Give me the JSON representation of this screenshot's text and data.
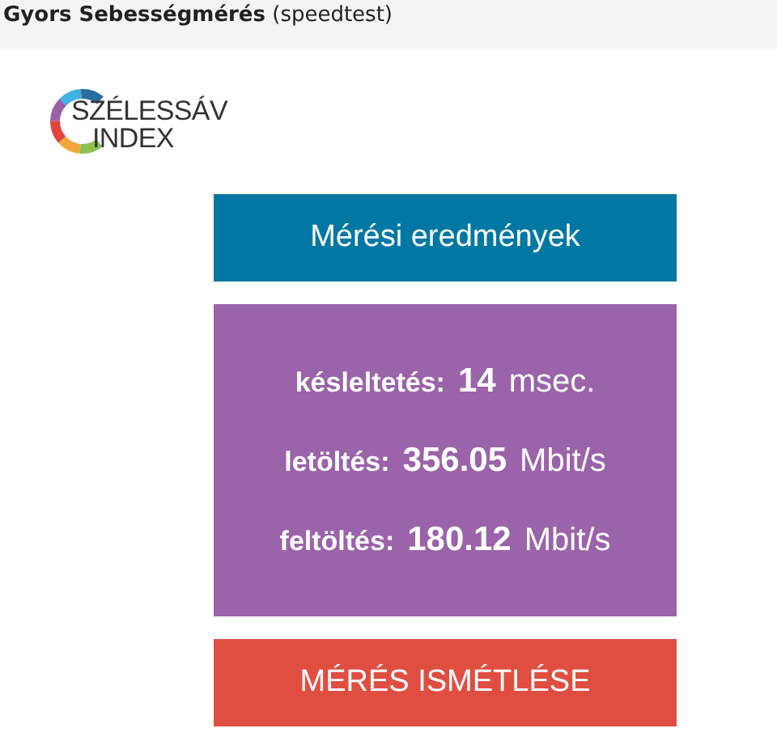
{
  "header": {
    "title": "**Gyors Sebességmérés** (speedtest)"
  },
  "logo": {
    "line_1": "SZÉLESSÁV",
    "line_2": "INDEX"
  },
  "results_heading": "Mérési eredmények",
  "results": [
    {
      "label": "késleltetés:",
      "value": "14",
      "unit": "msec."
    },
    {
      "label": "letöltés:",
      "value": "356.05",
      "unit": "Mbit/s"
    },
    {
      "label": "feltöltés:",
      "value": "180.12",
      "unit": "Mbit/s"
    }
  ],
  "repeat_button": "MÉRÉS ISMÉTLÉSE"
}
